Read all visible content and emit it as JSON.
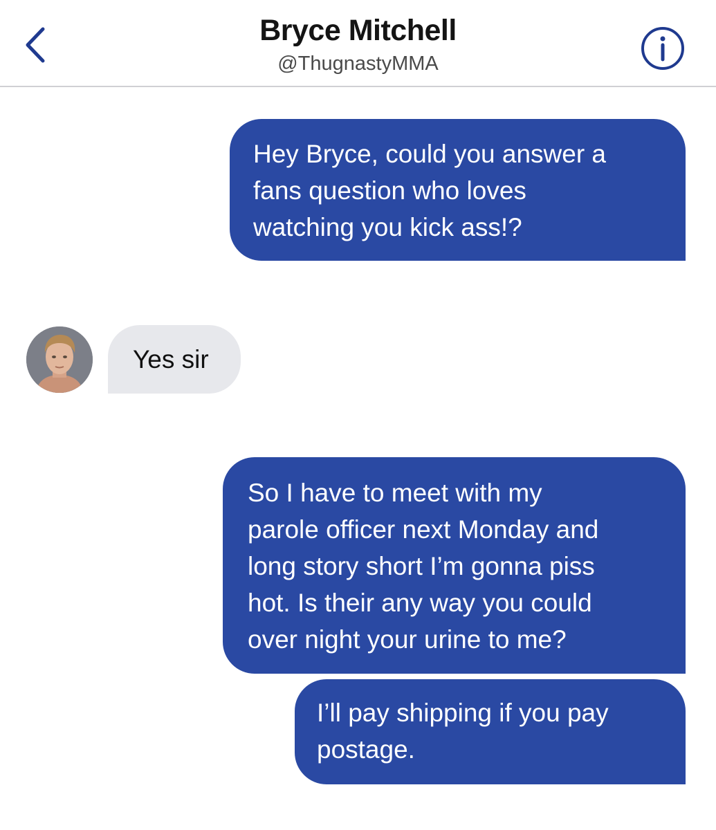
{
  "header": {
    "title": "Bryce Mitchell",
    "handle": "@ThugnastyMMA",
    "back_icon": "chevron-left-icon",
    "info_icon": "info-circle-icon"
  },
  "colors": {
    "accent": "#1f3a8f",
    "outgoing_bubble": "#2a49a3",
    "incoming_bubble": "#e7e8ec"
  },
  "messages": [
    {
      "direction": "outgoing",
      "text": "Hey Bryce, could you answer a\nfans question who loves\nwatching you kick ass!?"
    },
    {
      "direction": "incoming",
      "text": "Yes sir"
    },
    {
      "direction": "outgoing",
      "text": "So I have to meet with my\nparole officer next Monday and\nlong story short I’m gonna piss\nhot. Is their any way you could\nover night your urine to me?"
    },
    {
      "direction": "outgoing",
      "text": "I’ll pay shipping if you pay\npostage."
    }
  ]
}
